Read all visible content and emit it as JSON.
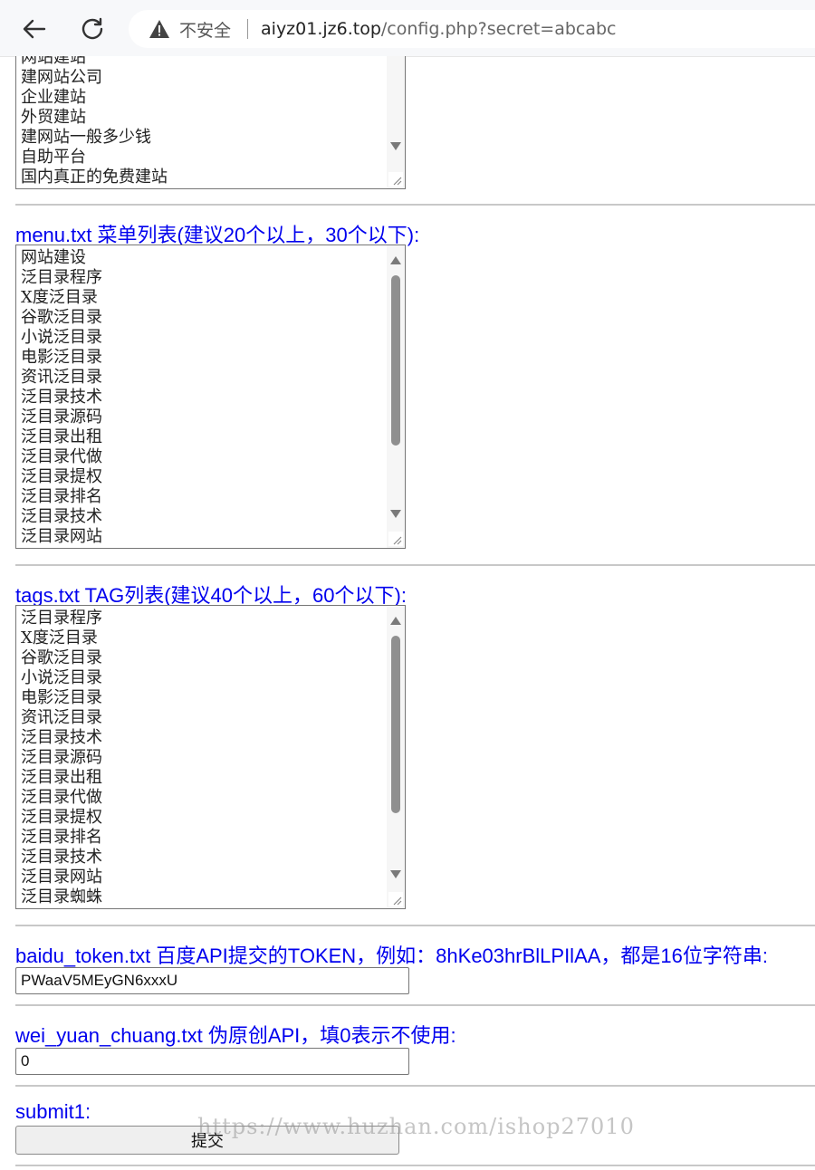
{
  "browser": {
    "insecure_label": "不安全",
    "url_host": "aiyz01.jz6.top",
    "url_path": "/config.php?secret=abcabc"
  },
  "keywords_list": {
    "lines": [
      "网站建站",
      "建网站公司",
      "企业建站",
      "外贸建站",
      "建网站一般多少钱",
      "自助平台",
      "国内真正的免费建站"
    ]
  },
  "menu": {
    "label": "menu.txt 菜单列表(建议20个以上，30个以下):",
    "lines": [
      "网站建设",
      "泛目录程序",
      "X度泛目录",
      "谷歌泛目录",
      "小说泛目录",
      "电影泛目录",
      "资讯泛目录",
      "泛目录技术",
      "泛目录源码",
      "泛目录出租",
      "泛目录代做",
      "泛目录提权",
      "泛目录排名",
      "泛目录技术",
      "泛目录网站"
    ]
  },
  "tags": {
    "label": "tags.txt TAG列表(建议40个以上，60个以下):",
    "lines": [
      "泛目录程序",
      "X度泛目录",
      "谷歌泛目录",
      "小说泛目录",
      "电影泛目录",
      "资讯泛目录",
      "泛目录技术",
      "泛目录源码",
      "泛目录出租",
      "泛目录代做",
      "泛目录提权",
      "泛目录排名",
      "泛目录技术",
      "泛目录网站",
      "泛目录蜘蛛"
    ]
  },
  "baidu_token": {
    "label": "baidu_token.txt 百度API提交的TOKEN，例如：8hKe03hrBlLPIlAA，都是16位字符串:",
    "value": "PWaaV5MEyGN6xxxU"
  },
  "wei_yuan_chuang": {
    "label": "wei_yuan_chuang.txt 伪原创API，填0表示不使用:",
    "value": "0"
  },
  "submit": {
    "label": "submit1:",
    "button_label": "提交"
  },
  "watermark": "https://www.huzhan.com/ishop27010"
}
